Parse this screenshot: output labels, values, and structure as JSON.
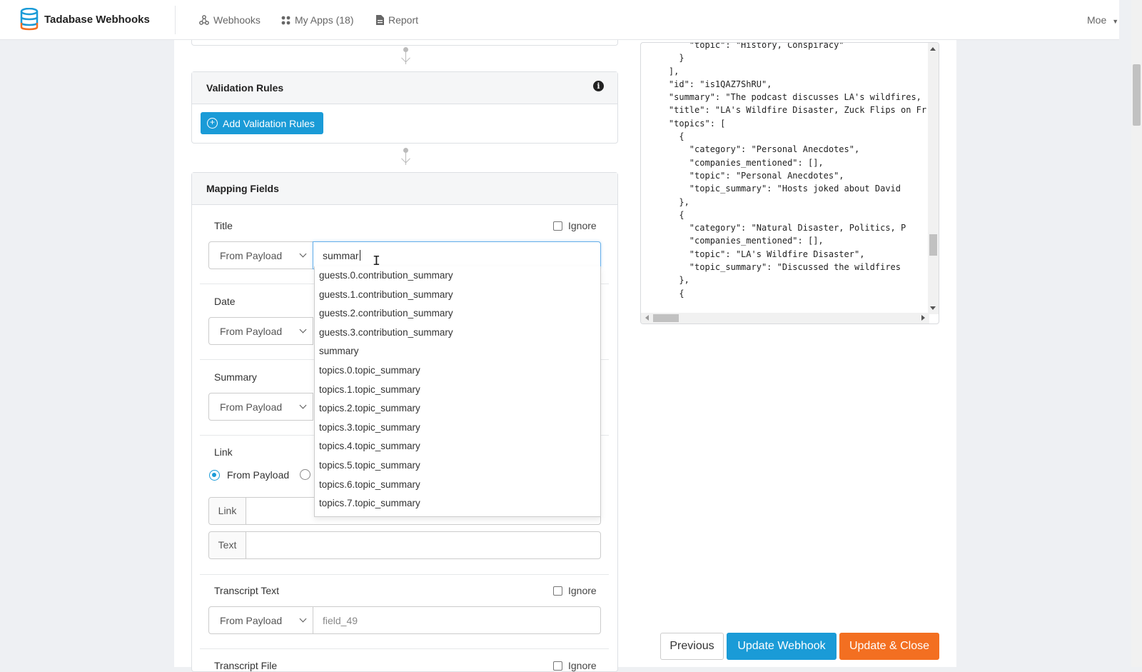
{
  "app": {
    "name": "Tadabase Webhooks"
  },
  "nav": [
    {
      "label": "Webhooks",
      "icon": "webhook-icon"
    },
    {
      "label": "My Apps (18)",
      "icon": "apps-grid-icon"
    },
    {
      "label": "Report",
      "icon": "report-icon"
    }
  ],
  "user": {
    "name": "Moe"
  },
  "validation": {
    "title": "Validation Rules",
    "add_label": "Add Validation Rules"
  },
  "mapping": {
    "title": "Mapping Fields",
    "ignore_label": "Ignore",
    "source_option": "From Payload",
    "fields": {
      "title": {
        "label": "Title",
        "value": "summar"
      },
      "date": {
        "label": "Date"
      },
      "summary": {
        "label": "Summary"
      },
      "link": {
        "label": "Link",
        "radio_selected": "From Payload",
        "link_label": "Link",
        "text_label": "Text"
      },
      "transcript_text": {
        "label": "Transcript Text",
        "value": "field_49"
      },
      "transcript_file": {
        "label": "Transcript File"
      }
    }
  },
  "suggestions": [
    "guests.0.contribution_summary",
    "guests.1.contribution_summary",
    "guests.2.contribution_summary",
    "guests.3.contribution_summary",
    "summary",
    "topics.0.topic_summary",
    "topics.1.topic_summary",
    "topics.2.topic_summary",
    "topics.3.topic_summary",
    "topics.4.topic_summary",
    "topics.5.topic_summary",
    "topics.6.topic_summary",
    "topics.7.topic_summary"
  ],
  "payload_json": "        \"topic\": \"History, Conspiracy\"\n      }\n    ],\n    \"id\": \"is1QAZ7ShRU\",\n    \"summary\": \"The podcast discusses LA's wildfires,\n    \"title\": \"LA's Wildfire Disaster, Zuck Flips on Fr\n    \"topics\": [\n      {\n        \"category\": \"Personal Anecdotes\",\n        \"companies_mentioned\": [],\n        \"topic\": \"Personal Anecdotes\",\n        \"topic_summary\": \"Hosts joked about David\n      },\n      {\n        \"category\": \"Natural Disaster, Politics, P\n        \"companies_mentioned\": [],\n        \"topic\": \"LA's Wildfire Disaster\",\n        \"topic_summary\": \"Discussed the wildfires\n      },\n      {",
  "footer": {
    "previous": "Previous",
    "update": "Update Webhook",
    "update_close": "Update & Close"
  },
  "colors": {
    "primary": "#1a9bd7",
    "accent": "#f36f21"
  }
}
